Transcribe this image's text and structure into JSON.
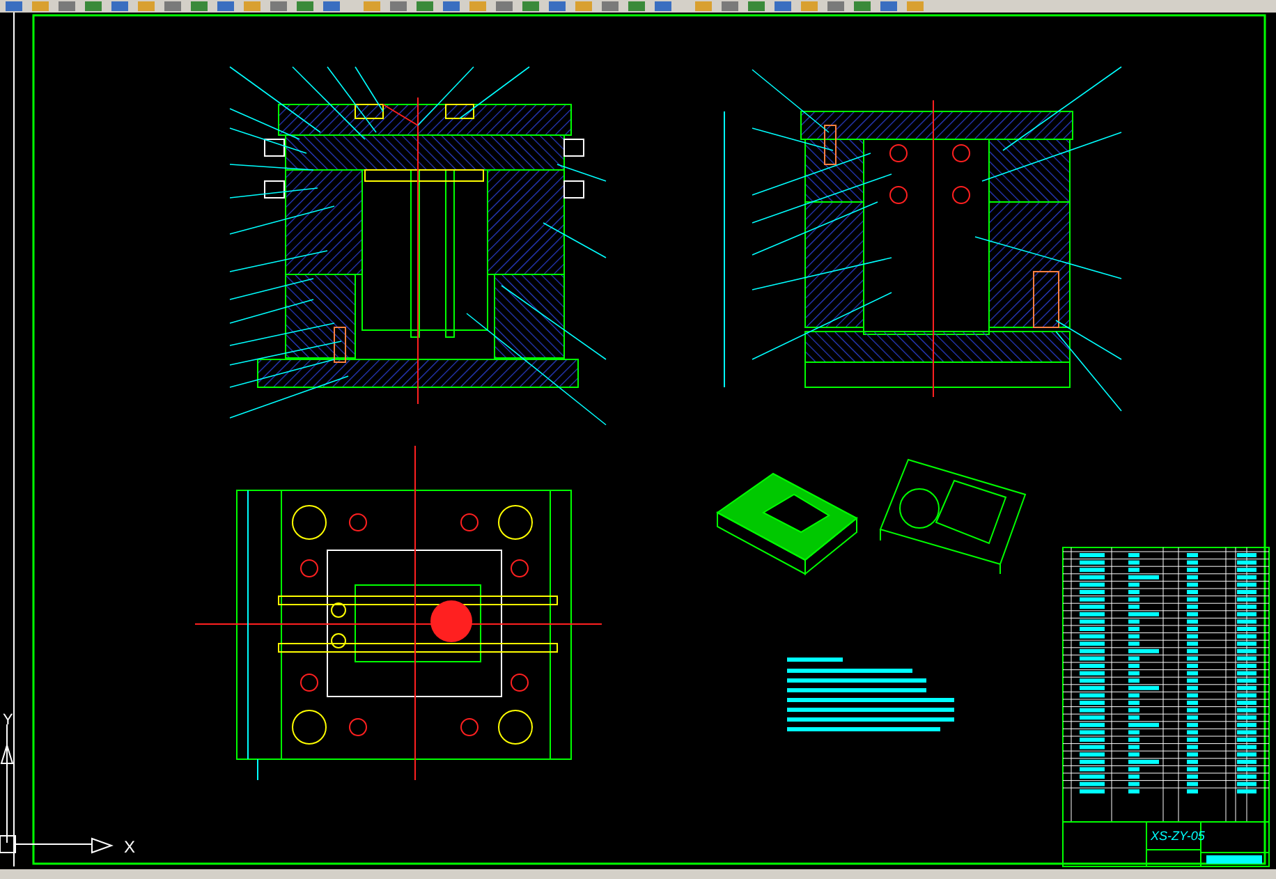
{
  "title_block": {
    "drawing_number": "XS-ZY-05"
  },
  "ucs": {
    "x_label": "X",
    "y_label": "Y"
  }
}
